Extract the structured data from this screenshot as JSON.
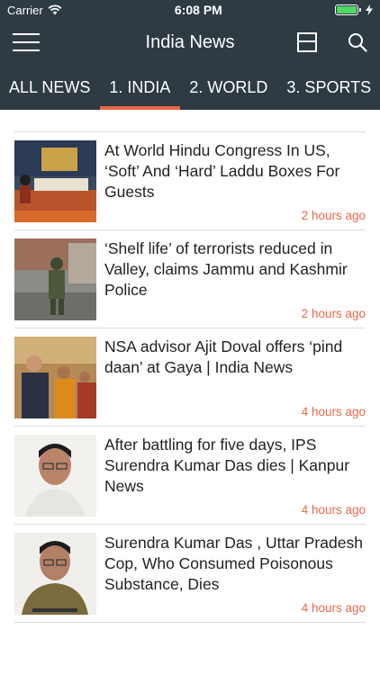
{
  "status": {
    "carrier": "Carrier",
    "time": "6:08 PM",
    "battery_level": 1.0
  },
  "nav": {
    "title": "India News",
    "menu_icon": "hamburger-icon",
    "layout_icon": "layout-toggle-icon",
    "search_icon": "search-icon"
  },
  "tabs": [
    {
      "label": "ALL NEWS",
      "active": false
    },
    {
      "label": "1. INDIA",
      "active": true
    },
    {
      "label": "2. WORLD",
      "active": false
    },
    {
      "label": "3. SPORTS",
      "active": false
    }
  ],
  "accent_color": "#e8674a",
  "header_color": "#2f3b43",
  "articles": [
    {
      "headline": "At World Hindu Congress In US, ‘Soft’ And ‘Hard’ Laddu Boxes For Guests",
      "time": "2 hours ago"
    },
    {
      "headline": "‘Shelf life’ of terrorists reduced in Valley, claims Jammu and Kashmir Police",
      "time": "2 hours ago"
    },
    {
      "headline": "NSA advisor Ajit Doval offers ‘pind daan’ at Gaya | India News",
      "time": "4 hours ago"
    },
    {
      "headline": "After battling for five days, IPS Surendra Kumar Das dies | Kanpur News",
      "time": "4 hours ago"
    },
    {
      "headline": "Surendra Kumar Das , Uttar Pradesh Cop, Who Consumed Poisonous Substance, Dies",
      "time": "4 hours ago"
    }
  ]
}
